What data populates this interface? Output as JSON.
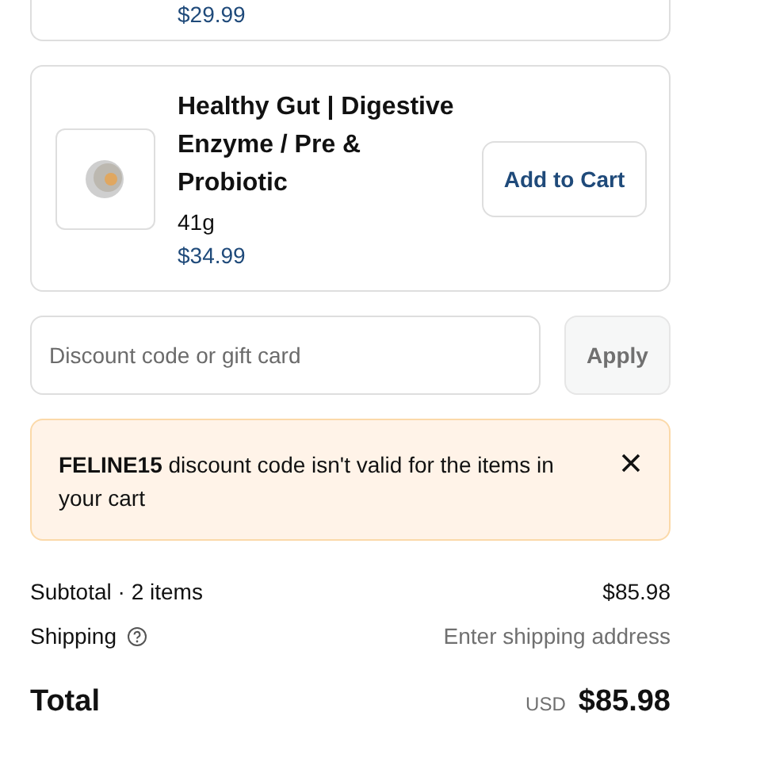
{
  "previous_item": {
    "price": "$29.99"
  },
  "product": {
    "title": "Healthy Gut | Digestive Enzyme / Pre & Probiotic",
    "variant": "41g",
    "price": "$34.99",
    "button": "Add to Cart"
  },
  "discount": {
    "placeholder": "Discount code or gift card",
    "button": "Apply",
    "button_disabled": true
  },
  "alert": {
    "message": "**FELINE15** discount code isn't valid for the items in your cart"
  },
  "summary": {
    "subtotal_label": "Subtotal · 2 items",
    "subtotal_value": "$85.98",
    "shipping_label": "Shipping",
    "shipping_value": "Enter shipping address",
    "total_label": "Total",
    "currency": "USD",
    "total_value": "$85.98"
  }
}
